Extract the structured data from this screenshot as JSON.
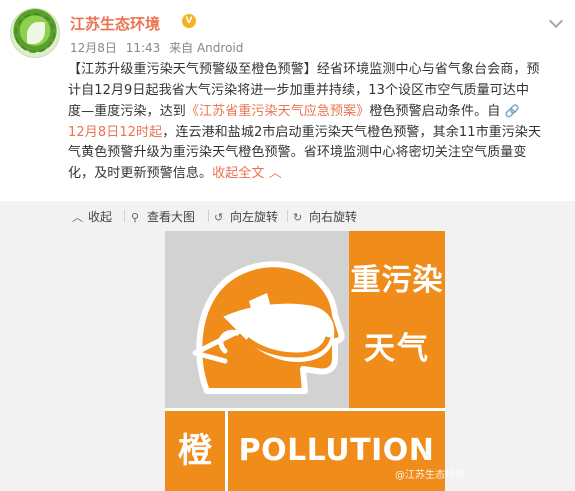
{
  "post": {
    "user_name": "江苏生态环境",
    "verified_mark": "V",
    "date": "12月8日",
    "time": "11:43",
    "source": "来自 Android"
  },
  "body": {
    "line1": "【江苏升级重污染天气预警级至橙色预警】经省环境监测中心与省气象台会商，预",
    "line2": "计自12月9日起我省大气污染将进一步加重并持续，13个设区市空气质量可达中",
    "line3_a": "度—重度污染，达到",
    "line3_link": "《江苏省重污染天气应急预案》",
    "line3_b": "橙色预警启动条件。自",
    "link_icon": "🔗",
    "line4_link": "12月8日12时起",
    "line4_b": "，连云港和盐城2市启动重污染天气橙色预警，其余11市重污染天",
    "line5": "气黄色预警升级为重污染天气橙色预警。省环境监测中心将密切关注空气质量变",
    "line6": "化，及时更新预警信息。",
    "collapse_label": "收起全文",
    "collapse_icon": "︿"
  },
  "toolbar": {
    "collapse": {
      "icon": "︿",
      "label": "收起"
    },
    "view_large": {
      "icon": "⚲",
      "label": "查看大图"
    },
    "rotate_left": {
      "icon": "↺",
      "label": "向左旋转"
    },
    "rotate_right": {
      "icon": "↻",
      "label": "向右旋转"
    }
  },
  "poster": {
    "word_line1": "重污染",
    "word_line2": "天气",
    "level": "橙",
    "pollution": "POLLUTION",
    "watermark": "@江苏生态环境"
  },
  "icons": {
    "avatar": "avatar-logo",
    "verified": "verified-badge-icon",
    "menu": "chevron-down-icon"
  },
  "colors": {
    "accent": "#eb7350",
    "poster_orange": "#f08c1a",
    "poster_grey": "#d2d2d2",
    "toolbar_bg": "#f2f2f2"
  }
}
